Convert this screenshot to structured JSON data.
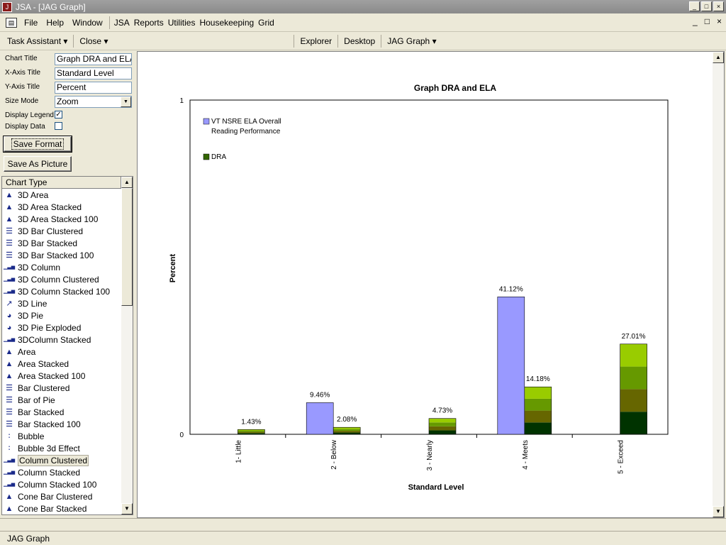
{
  "window": {
    "title": "JSA - [JAG Graph]",
    "app_icon": "app-icon",
    "controls": [
      "_",
      "□",
      "×"
    ]
  },
  "menubar": {
    "items": [
      "File",
      "Help",
      "Window",
      "JSA",
      "Reports",
      "Utilities",
      "Housekeeping",
      "Grid"
    ]
  },
  "mdi_controls": [
    "_",
    "□",
    "×"
  ],
  "toolbar": {
    "task_assistant": "Task Assistant",
    "close": "Close",
    "explorer": "Explorer",
    "desktop": "Desktop",
    "jag_graph": "JAG Graph"
  },
  "properties": {
    "chart_title_label": "Chart Title",
    "chart_title_value": "Graph DRA and ELA",
    "x_axis_label": "X-Axis Title",
    "x_axis_value": "Standard Level",
    "y_axis_label": "Y-Axis Title",
    "y_axis_value": "Percent",
    "size_mode_label": "Size Mode",
    "size_mode_value": "Zoom",
    "display_legend_label": "Display Legend",
    "display_legend_checked": true,
    "display_data_label": "Display Data",
    "display_data_checked": false
  },
  "buttons": {
    "save_format": "Save Format",
    "save_picture": "Save As Picture"
  },
  "chart_type_list": {
    "header": "Chart Type",
    "selected": "Column Clustered",
    "items": [
      {
        "label": "3D Area",
        "icon": "area-chart-icon"
      },
      {
        "label": "3D Area Stacked",
        "icon": "area-chart-icon"
      },
      {
        "label": "3D Area Stacked 100",
        "icon": "area-chart-icon"
      },
      {
        "label": "3D Bar Clustered",
        "icon": "bar-chart-icon"
      },
      {
        "label": "3D Bar Stacked",
        "icon": "bar-chart-icon"
      },
      {
        "label": "3D Bar Stacked 100",
        "icon": "bar-chart-icon"
      },
      {
        "label": "3D Column",
        "icon": "column-chart-icon"
      },
      {
        "label": "3D Column Clustered",
        "icon": "column-chart-icon"
      },
      {
        "label": "3D Column Stacked 100",
        "icon": "column-chart-icon"
      },
      {
        "label": "3D Line",
        "icon": "line-chart-icon"
      },
      {
        "label": "3D Pie",
        "icon": "pie-chart-icon"
      },
      {
        "label": "3D Pie Exploded",
        "icon": "pie-chart-icon"
      },
      {
        "label": "3DColumn Stacked",
        "icon": "column-chart-icon"
      },
      {
        "label": "Area",
        "icon": "area-chart-icon"
      },
      {
        "label": "Area Stacked",
        "icon": "area-chart-icon"
      },
      {
        "label": "Area Stacked 100",
        "icon": "area-chart-icon"
      },
      {
        "label": "Bar Clustered",
        "icon": "bar-chart-icon"
      },
      {
        "label": "Bar of Pie",
        "icon": "bar-chart-icon"
      },
      {
        "label": "Bar Stacked",
        "icon": "bar-chart-icon"
      },
      {
        "label": "Bar Stacked 100",
        "icon": "bar-chart-icon"
      },
      {
        "label": "Bubble",
        "icon": "bubble-chart-icon"
      },
      {
        "label": "Bubble 3d Effect",
        "icon": "bubble-chart-icon"
      },
      {
        "label": "Column Clustered",
        "icon": "column-chart-icon"
      },
      {
        "label": "Column Stacked",
        "icon": "column-chart-icon"
      },
      {
        "label": "Column Stacked 100",
        "icon": "column-chart-icon"
      },
      {
        "label": "Cone Bar Clustered",
        "icon": "cone-chart-icon"
      },
      {
        "label": "Cone Bar Stacked",
        "icon": "cone-chart-icon"
      }
    ]
  },
  "colors": {
    "ela": "#9999ff",
    "dra_shades": [
      "#003300",
      "#666600",
      "#669900",
      "#99cc00"
    ],
    "dra_legend": "#336600"
  },
  "chart_data": {
    "type": "bar",
    "title": "Graph DRA and ELA",
    "xlabel": "Standard Level",
    "ylabel": "Percent",
    "ylim": [
      0,
      1
    ],
    "yticks": [
      "0",
      "1"
    ],
    "categories": [
      "1- Little",
      "2 - Below",
      "3 - Nearly",
      "4 - Meets",
      "5 - Exceed"
    ],
    "series": [
      {
        "name": "VT NSRE ELA Overall Reading Performance",
        "values": [
          null,
          0.0946,
          null,
          0.4112,
          null
        ],
        "labels": [
          "",
          "9.46%",
          "",
          "41.12%",
          ""
        ]
      },
      {
        "name": "DRA",
        "values": [
          0.0143,
          0.0208,
          0.0473,
          0.1418,
          0.2701
        ],
        "labels": [
          "1.43%",
          "2.08%",
          "4.73%",
          "14.18%",
          "27.01%"
        ]
      }
    ],
    "legend": [
      "VT NSRE ELA Overall",
      "Reading Performance",
      "DRA"
    ],
    "legend_position": "top-left",
    "grid": false
  },
  "status": {
    "text": "JAG Graph"
  }
}
